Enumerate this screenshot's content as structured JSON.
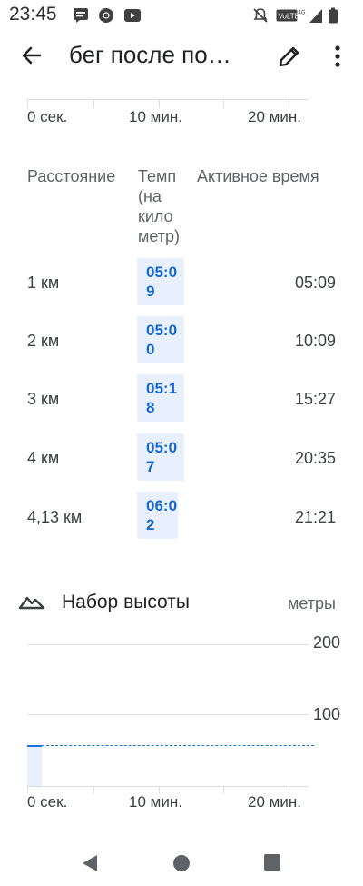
{
  "status_bar": {
    "time": "23:45",
    "volte_label": "VoLTE",
    "network_label": "4G",
    "icons": [
      "message-icon",
      "chrome-icon",
      "youtube-icon",
      "mute-icon",
      "volte-icon",
      "signal-icon",
      "battery-icon"
    ]
  },
  "app_bar": {
    "title": "бег после по…",
    "icons": [
      "back-arrow-icon",
      "edit-pencil-icon",
      "more-vert-icon"
    ]
  },
  "pace_chart_axis": {
    "ticks": [
      "0 сек.",
      "10 мин.",
      "20 мин."
    ]
  },
  "splits_table": {
    "headers": {
      "distance": "Расстояние",
      "pace": "Темп (на кило метр)",
      "active_time": "Активное время"
    },
    "rows": [
      {
        "distance": "1 км",
        "pace": "05:09",
        "active_time": "05:09"
      },
      {
        "distance": "2 км",
        "pace": "05:00",
        "active_time": "10:09"
      },
      {
        "distance": "3 км",
        "pace": "05:18",
        "active_time": "15:27"
      },
      {
        "distance": "4 км",
        "pace": "05:07",
        "active_time": "20:35"
      },
      {
        "distance": "4,13 км",
        "pace": "06:02",
        "active_time": "21:21"
      }
    ]
  },
  "elevation": {
    "title": "Набор высоты",
    "units": "метры",
    "icon": "mountain-icon",
    "y_ticks": [
      "200",
      "100"
    ],
    "x_ticks": [
      "0 сек.",
      "10 мин.",
      "20 мин."
    ]
  },
  "nav_bar": {
    "icons": [
      "nav-back-icon",
      "nav-home-icon",
      "nav-recents-icon"
    ]
  },
  "colors": {
    "accent": "#1967d2",
    "chip_bg": "#e8f0fe",
    "chart_line": "#1a73e8"
  }
}
